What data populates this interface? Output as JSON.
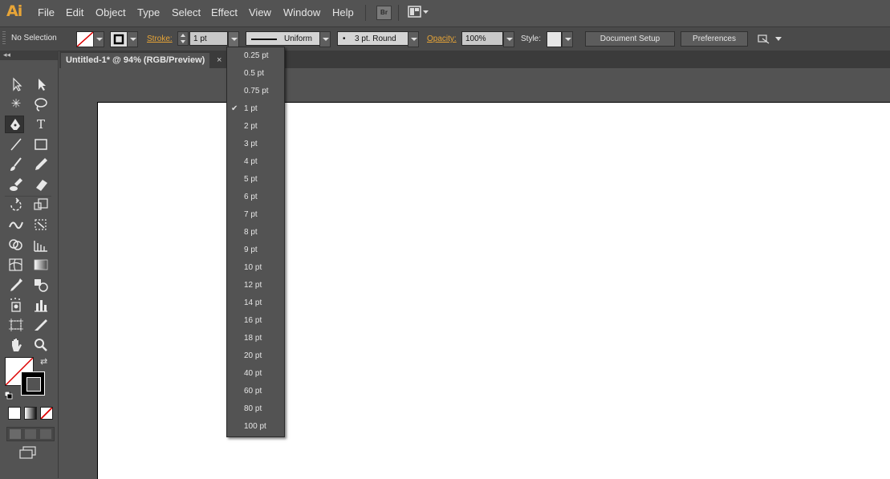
{
  "app": {
    "logo": "Ai",
    "bridge_label": "Br"
  },
  "menu": [
    "File",
    "Edit",
    "Object",
    "Type",
    "Select",
    "Effect",
    "View",
    "Window",
    "Help"
  ],
  "control": {
    "selection": "No Selection",
    "stroke_label": "Stroke:",
    "stroke_value": "1 pt",
    "profile": "Uniform",
    "brush": "3 pt. Round",
    "opacity_label": "Opacity:",
    "opacity_value": "100%",
    "style_label": "Style:",
    "document_setup": "Document Setup",
    "preferences": "Preferences"
  },
  "document": {
    "tab_title": "Untitled-1* @ 94% (RGB/Preview)",
    "close": "×"
  },
  "toolbox": {
    "collapse": "◂◂"
  },
  "stroke_dropdown": {
    "selected": "1 pt",
    "options": [
      "0.25 pt",
      "0.5 pt",
      "0.75 pt",
      "1 pt",
      "2 pt",
      "3 pt",
      "4 pt",
      "5 pt",
      "6 pt",
      "7 pt",
      "8 pt",
      "9 pt",
      "10 pt",
      "12 pt",
      "14 pt",
      "16 pt",
      "18 pt",
      "20 pt",
      "40 pt",
      "60 pt",
      "80 pt",
      "100 pt"
    ]
  },
  "colors": {
    "accent": "#e8a537",
    "panel": "#535353",
    "artboard": "#ffffff"
  }
}
